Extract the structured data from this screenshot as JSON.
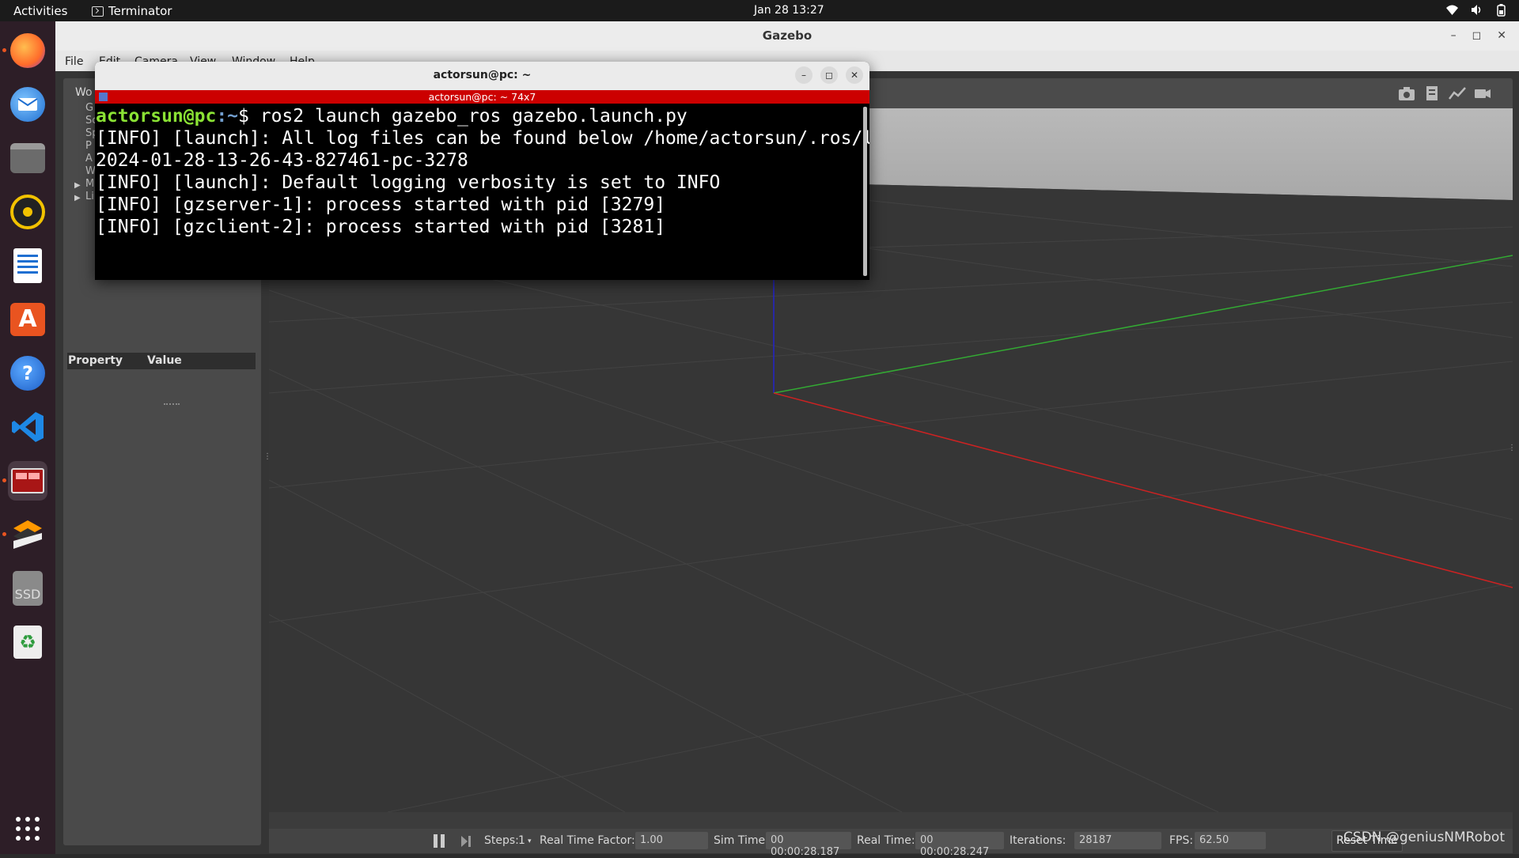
{
  "topbar": {
    "activities": "Activities",
    "app_name": "Terminator",
    "clock": "Jan 28  13:27"
  },
  "dock": {
    "items": [
      {
        "name": "firefox-icon",
        "running": true
      },
      {
        "name": "thunderbird-icon",
        "running": false
      },
      {
        "name": "files-icon",
        "running": false
      },
      {
        "name": "rhythmbox-icon",
        "running": false
      },
      {
        "name": "writer-icon",
        "running": false
      },
      {
        "name": "app-center-icon",
        "running": false
      },
      {
        "name": "help-icon",
        "running": false
      },
      {
        "name": "vscode-icon",
        "running": false
      },
      {
        "name": "terminator-icon",
        "running": true
      },
      {
        "name": "sublime-icon",
        "running": true
      },
      {
        "name": "ssd-icon",
        "running": false
      },
      {
        "name": "trash-icon",
        "running": false
      }
    ],
    "ssd_label": "SSD"
  },
  "gazebo": {
    "title": "Gazebo",
    "menu": [
      "File",
      "Edit",
      "Camera",
      "View",
      "Window",
      "Help"
    ],
    "world_tab": "Wo",
    "tree": [
      "G",
      "Sc",
      "Sp",
      "P",
      "A",
      "W",
      "M",
      "Li"
    ],
    "property_header": "Property",
    "value_header": "Value",
    "bottom": {
      "steps_label": "Steps:",
      "steps_value": "1",
      "rtf_label": "Real Time Factor:",
      "rtf_value": "1.00",
      "sim_label": "Sim Time:",
      "sim_value": "00 00:00:28.187",
      "real_label": "Real Time:",
      "real_value": "00 00:00:28.247",
      "iter_label": "Iterations:",
      "iter_value": "28187",
      "fps_label": "FPS:",
      "fps_value": "62.50",
      "reset_label": "Reset Time"
    }
  },
  "terminal": {
    "title": "actorsun@pc: ~",
    "subtitle": "actorsun@pc: ~ 74x7",
    "prompt_user": "actorsun@pc",
    "prompt_path": ":~",
    "command": "$ ros2 launch gazebo_ros gazebo.launch.py",
    "lines": [
      "[INFO] [launch]: All log files can be found below /home/actorsun/.ros/log/",
      "2024-01-28-13-26-43-827461-pc-3278",
      "[INFO] [launch]: Default logging verbosity is set to INFO",
      "[INFO] [gzserver-1]: process started with pid [3279]",
      "[INFO] [gzclient-2]: process started with pid [3281]"
    ]
  },
  "watermark": "CSDN @geniusNMRobot",
  "colors": {
    "dock_bg": "#2d1e27",
    "term_user": "#8ae234",
    "term_path": "#729fcf",
    "term_bar": "#cc0000",
    "axis_x": "#cc2222",
    "axis_y": "#33aa33",
    "axis_z": "#2222cc"
  }
}
